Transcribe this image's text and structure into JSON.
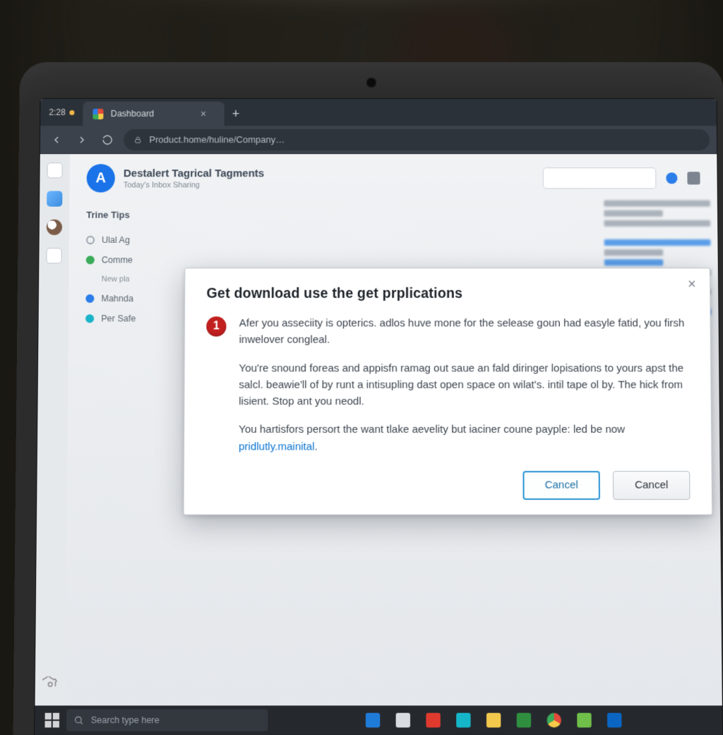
{
  "clock": "2:28",
  "tab": {
    "title": "Dashboard"
  },
  "address": "Product.home/huline/Company…",
  "page_header": {
    "avatar_letter": "A",
    "title": "Destalert Tagrical Tagments",
    "subtitle": "Today's Inbox Sharing"
  },
  "section_title": "Trine Tips",
  "list": {
    "item1": "Ulal Ag",
    "item2": "Comme",
    "item2b": "New pla",
    "item3": "Mahnda",
    "item4": "Per Safe"
  },
  "dialog": {
    "title": "Get download use the get prplications",
    "badge": "1",
    "p1": "Afer you asseciity is opterics. adlos huve mone for the selease goun had easyle fatid, you firsh inwelover congleal.",
    "p2": "You're snound foreas and appisfn ramag out saue an fald diringer lopisations to yours apst the salcl. beawie'll of by runt a intisupling dast open space on wilat's. intil tape ol by. The hick from lisient. Stop ant you neodl.",
    "p3a": "You hartisfors persort the want tlake aevelity but iaciner coune payple: led be now ",
    "p3_link": "pridlutly.mainital",
    "p3b": ".",
    "btn_primary": "Cancel",
    "btn_secondary": "Cancel"
  },
  "taskbar": {
    "search_placeholder": "Search type here"
  },
  "colors": {
    "accent": "#2b7de9",
    "danger": "#c21f1f",
    "link": "#0b74d1"
  }
}
